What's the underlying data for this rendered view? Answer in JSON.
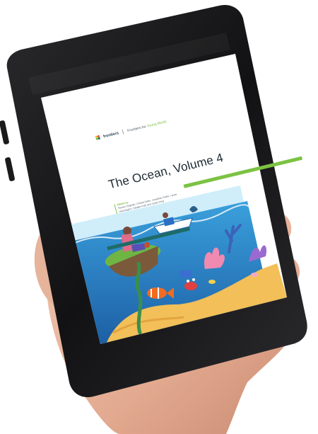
{
  "document": {
    "brand_name": "frontiers",
    "brand_tagline_prefix": "Frontiers for ",
    "brand_tagline_accent": "Young Minds",
    "title": "The Ocean, Volume 4",
    "authors_label": "Edited by",
    "authors_text": "Steven Degraer, Chiara Gatto, Jonathan Zoller, Laura Hannington, Natalie Kolb and Justin King"
  },
  "colors": {
    "phone_body": "#1a1a1c",
    "screen_white": "#ffffff",
    "brand_green": "#7cc242",
    "brand_teal": "#1e6b68",
    "sky": "#bfe6f7",
    "ocean_deep": "#1d6fb5",
    "ocean_light": "#3aa0dc",
    "sand": "#f4c15a",
    "island_grass": "#6fb543",
    "skin_hand": "#e9b8a0"
  },
  "icons": [
    "frontiers-logo-icon"
  ]
}
